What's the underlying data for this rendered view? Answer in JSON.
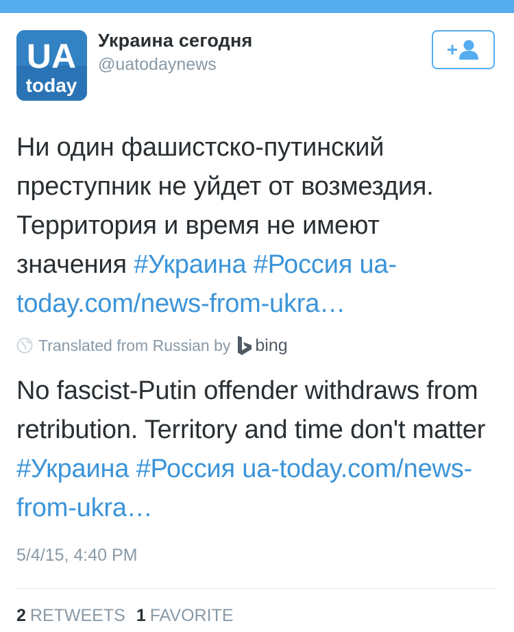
{
  "colors": {
    "accent": "#55acee",
    "link": "#3b94d9",
    "text": "#292f33",
    "muted": "#8899a6",
    "avatar_bg": "#2a74b5"
  },
  "author": {
    "display_name": "Украина сегодня",
    "handle": "@uatodaynews",
    "avatar_text_top": "UA",
    "avatar_text_bottom": "today",
    "follow_icon": "add-user-icon"
  },
  "tweet": {
    "text_plain": "Ни один фашистско-путинский преступник не уйдет от возмездия. Территория и время не имеют значения ",
    "hashtag_1": "#Украина",
    "hashtag_2": "#Россия",
    "link": "ua-today.com/news-from-ukra…"
  },
  "translation": {
    "globe_icon": "globe-icon",
    "label": "Translated from Russian by",
    "provider": "bing",
    "text_plain": "No fascist-Putin offender withdraws from retribution. Territory and time don't matter ",
    "hashtag_1": "#Украина",
    "hashtag_2": "#Россия",
    "link": "ua-today.com/news-from-ukra…"
  },
  "meta": {
    "timestamp": "5/4/15, 4:40 PM"
  },
  "stats": {
    "retweets_count": "2",
    "retweets_label": "RETWEETS",
    "favorites_count": "1",
    "favorites_label": "FAVORITE"
  }
}
